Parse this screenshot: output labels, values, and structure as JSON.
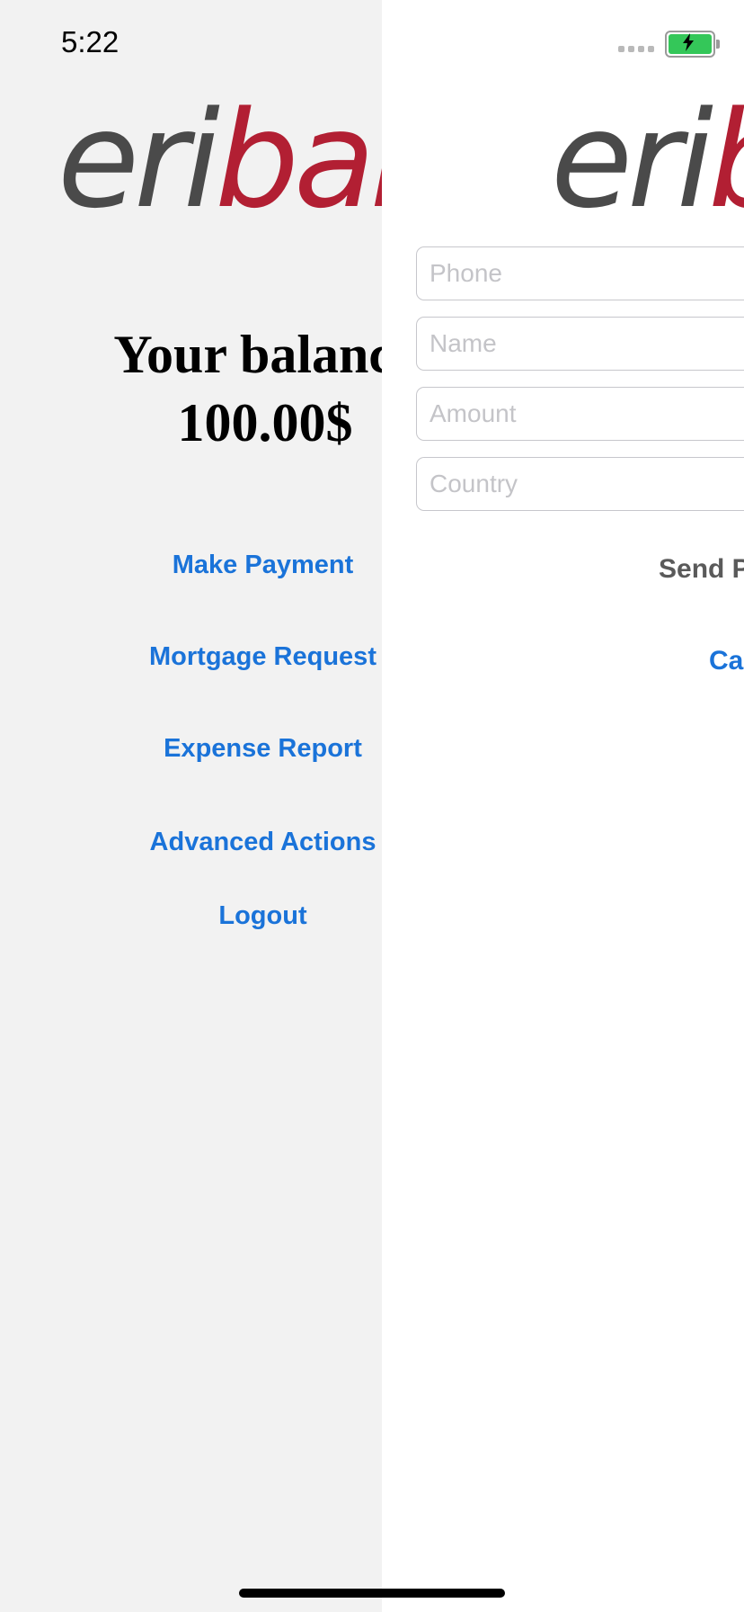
{
  "status_bar": {
    "time": "5:22",
    "battery_color": "#34c759"
  },
  "home_screen": {
    "logo": {
      "part1": "eri",
      "part2": "bank"
    },
    "balance_label": "Your balance",
    "balance_amount": "100.00$",
    "menu": [
      {
        "label": "Make Payment"
      },
      {
        "label": "Mortgage Request"
      },
      {
        "label": "Expense Report"
      },
      {
        "label": "Advanced Actions"
      },
      {
        "label": "Logout"
      }
    ]
  },
  "payment_screen": {
    "logo": {
      "part1": "eri",
      "part2": "bank"
    },
    "fields": [
      {
        "placeholder": "Phone",
        "value": ""
      },
      {
        "placeholder": "Name",
        "value": ""
      },
      {
        "placeholder": "Amount",
        "value": ""
      },
      {
        "placeholder": "Country",
        "value": ""
      }
    ],
    "send_label": "Send Payment",
    "cancel_label": "Cancel"
  },
  "colors": {
    "link": "#1a73d9",
    "brand_red": "#b21f33",
    "brand_gray": "#4a4a4a",
    "left_background": "#f2f2f2"
  }
}
